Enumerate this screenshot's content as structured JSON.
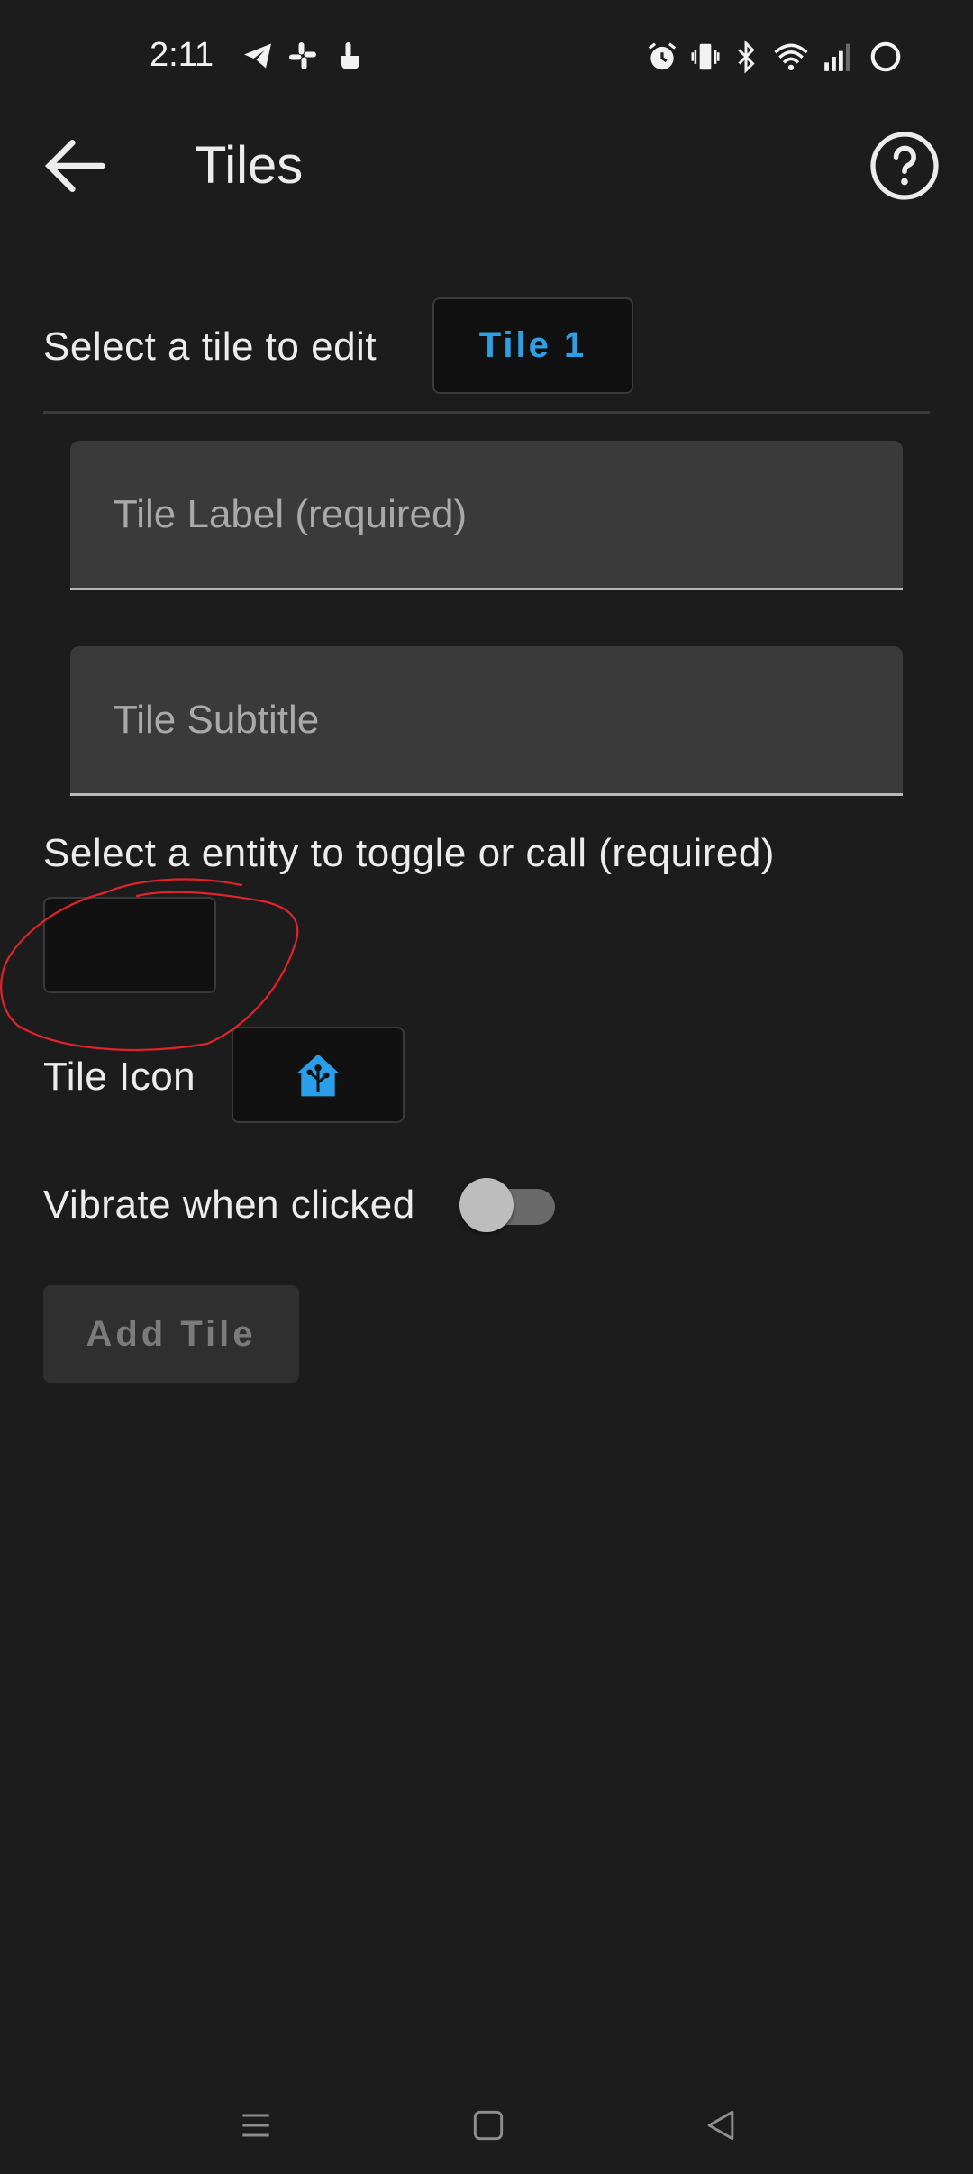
{
  "status_bar": {
    "time": "2:11",
    "left_icons": [
      "telegram-icon",
      "slack-icon",
      "touch-icon"
    ],
    "right_icons": [
      "alarm-icon",
      "vibrate-icon",
      "bluetooth-icon",
      "wifi-icon",
      "signal-icon",
      "circle-icon"
    ]
  },
  "app_bar": {
    "title": "Tiles",
    "back_icon": "arrow-left-icon",
    "help_icon": "help-circle-icon"
  },
  "tile_selector": {
    "label": "Select a tile to edit",
    "selected": "Tile 1"
  },
  "fields": {
    "tile_label": {
      "value": "",
      "placeholder": "Tile Label (required)"
    },
    "tile_subtitle": {
      "value": "",
      "placeholder": "Tile Subtitle"
    }
  },
  "entity": {
    "label": "Select a entity to toggle or call (required)",
    "selected": ""
  },
  "tile_icon": {
    "label": "Tile Icon",
    "icon": "home-assistant-icon"
  },
  "vibrate": {
    "label": "Vibrate when clicked",
    "enabled": false
  },
  "add_button": {
    "label": "Add Tile"
  },
  "colors": {
    "background": "#1c1c1d",
    "accent": "#2f9fe4",
    "annotation": "#e0232b"
  },
  "nav_bar": {
    "icons": [
      "recents-icon",
      "home-icon",
      "back-icon"
    ]
  }
}
